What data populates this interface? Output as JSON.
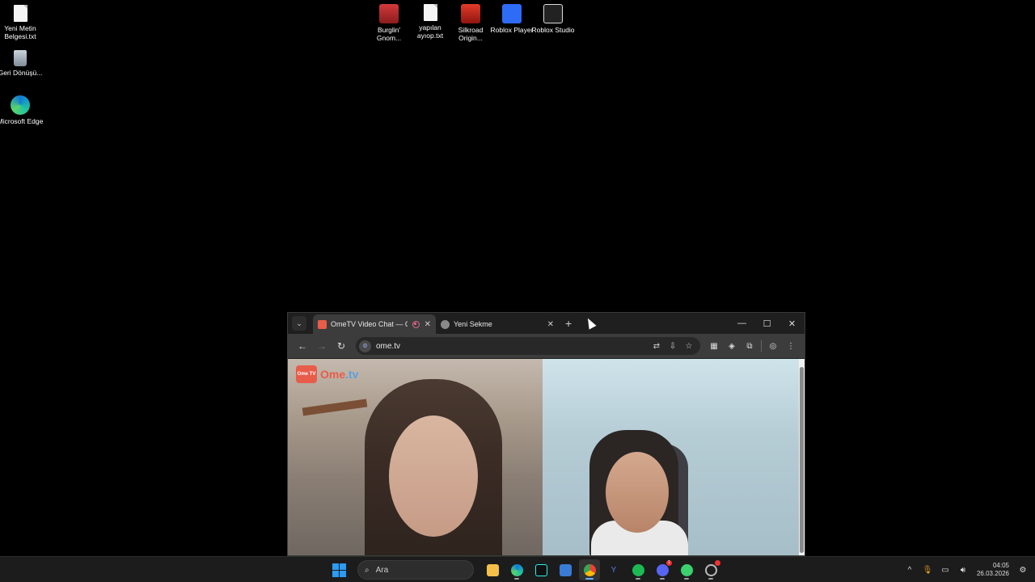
{
  "desktop": {
    "left_icons": [
      {
        "label": "Yeni Metin Belgesi.txt",
        "icon": "text-file-icon"
      },
      {
        "label": "Geri Dönüşü...",
        "icon": "recycle-bin-icon"
      },
      {
        "label": "Microsoft Edge",
        "icon": "edge-icon"
      }
    ],
    "top_icons": [
      {
        "label": "Burglin' Gnom...",
        "icon": "burglin-gnomes-icon"
      },
      {
        "label": "yapılan ayıop.txt",
        "icon": "text-file-icon"
      },
      {
        "label": "Silkroad Origin...",
        "icon": "silkroad-icon"
      },
      {
        "label": "Roblox Player",
        "icon": "roblox-icon"
      },
      {
        "label": "Roblox Studio",
        "icon": "roblox-studio-icon"
      }
    ]
  },
  "browser": {
    "tabs": [
      {
        "title": "OmeTV Video Chat — Ome",
        "active": true,
        "recording": true
      },
      {
        "title": "Yeni Sekme",
        "active": false
      }
    ],
    "new_tab": "+",
    "controls": {
      "minimize": "—",
      "maximize": "☐",
      "close": "✕"
    },
    "address": "ome.tv",
    "brand": {
      "left": "Ome",
      "right": ".tv",
      "badge": "Ome TV"
    }
  },
  "taskbar": {
    "search_placeholder": "Ara",
    "apps": [
      "file-explorer",
      "edge",
      "tiktok",
      "store",
      "chrome",
      "yandex",
      "spotify",
      "discord",
      "messenger",
      "extra"
    ],
    "discord_badge": "1",
    "clock": {
      "time": "04:05",
      "date": "26.03.2026"
    }
  },
  "colors": {
    "accent": "#2b9bf4",
    "brand": "#e85c4a"
  }
}
